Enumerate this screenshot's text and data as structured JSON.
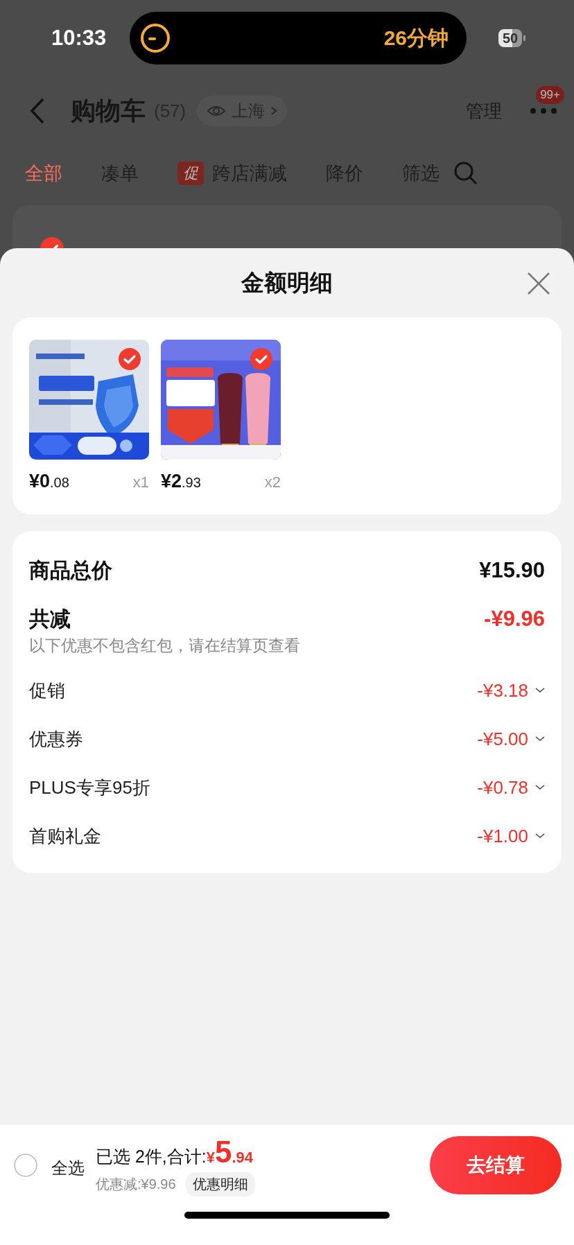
{
  "status_bar": {
    "time": "10:33",
    "activity": "26分钟",
    "battery": "50"
  },
  "header": {
    "title": "购物车",
    "count": "(57)",
    "location": "上海",
    "manage": "管理",
    "badge": "99+"
  },
  "tabs": [
    {
      "label": "全部",
      "selected": true
    },
    {
      "label": "凑单",
      "selected": false
    },
    {
      "label": "跨店满减",
      "selected": false,
      "tag": "促"
    },
    {
      "label": "降价",
      "selected": false
    },
    {
      "label": "筛选",
      "selected": false
    }
  ],
  "store_card": {
    "checked": true
  },
  "sheet": {
    "title": "金额明细"
  },
  "items": [
    {
      "price": "¥0.08",
      "qty": "x1",
      "checked": true,
      "kind": "picture"
    },
    {
      "price": "¥2.93",
      "qty": "x2",
      "checked": true,
      "kind": "picture"
    }
  ],
  "summary": {
    "total": {
      "label": "商品总价",
      "value": "¥15.90"
    },
    "discount": {
      "label": "共减",
      "value": "-¥9.96",
      "note": "以下优惠不包含红包，请在结算页查看"
    },
    "breakdown": [
      {
        "label": "促销",
        "value": "-¥3.18"
      },
      {
        "label": "优惠券",
        "value": "-¥5.00"
      },
      {
        "label": "PLUS专享95折",
        "value": "-¥0.78"
      },
      {
        "label": "首购礼金",
        "value": "-¥1.00"
      }
    ]
  },
  "footer": {
    "select_all": {
      "label": "全选",
      "checked": false
    },
    "selected_text": "已选 2件,合计:",
    "total": "¥5.94",
    "saving": "优惠减:¥9.96",
    "details": "优惠明细",
    "checkout": "去结算"
  }
}
